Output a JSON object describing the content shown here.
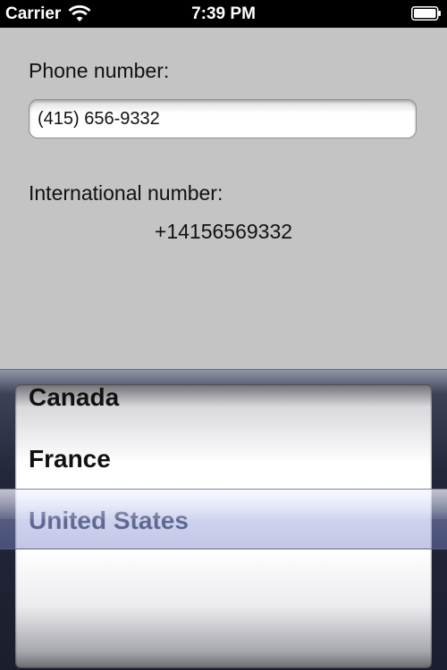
{
  "status_bar": {
    "carrier": "Carrier",
    "time": "7:39 PM"
  },
  "icons": {
    "wifi": "wifi-icon",
    "battery": "battery-icon"
  },
  "form": {
    "phone_label": "Phone number:",
    "phone_value": "(415) 656-9332",
    "intl_label": "International number:",
    "intl_value": "+14156569332"
  },
  "picker": {
    "options": [
      "Canada",
      "France",
      "United States"
    ],
    "selected": "United States"
  },
  "colors": {
    "background": "#c4c4c4",
    "status_bar": "#000000",
    "picker_frame": "#23273a",
    "selection_tint": "#8c96d8"
  }
}
